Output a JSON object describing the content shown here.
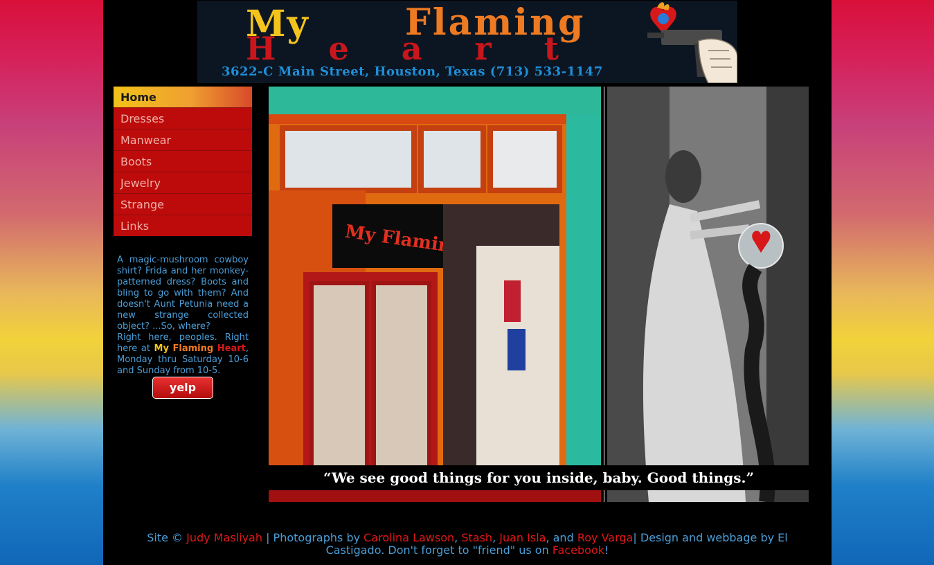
{
  "header": {
    "word_my": "My",
    "word_flaming": "Flaming",
    "word_heart": "Heart",
    "address": "3622-C Main Street, Houston, Texas (713) 533-1147",
    "logo_icon": "flaming-heart-pistol-icon"
  },
  "nav": {
    "items": [
      {
        "label": "Home",
        "active": true
      },
      {
        "label": "Dresses"
      },
      {
        "label": "Manwear"
      },
      {
        "label": "Boots"
      },
      {
        "label": "Jewelry"
      },
      {
        "label": "Strange"
      },
      {
        "label": "Links"
      }
    ]
  },
  "blurb": {
    "text1": "A magic-mushroom cowboy shirt? Frida and her monkey-patterned dress? Boots and bling to go with them? And doesn't Aunt Petunia need a new strange collected object? ...So, where?",
    "text2": "Right here, peoples. Right here at",
    "my": "My",
    "flaming": "Flaming",
    "heart": "Heart",
    "text3": ", Monday thru Saturday 10-6 and Sunday from 10-5.",
    "yelp_label": "yelp"
  },
  "photo": {
    "storefront_sign": "My Flaming Heart",
    "caption": "“We see good things for you inside, baby. Good things.”"
  },
  "footer": {
    "site": "Site ©",
    "owner": "Judy Masliyah",
    "photos_by": "| Photographs by",
    "photographer1": "Carolina Lawson",
    "sep1": ",",
    "photographer2": "Stash",
    "sep2": ",",
    "photographer3": "Juan Isla",
    "and": ", and",
    "photographer4": "Roy Varga",
    "design": "| Design and webbage by El Castigado. Don't forget to \"friend\" us on",
    "facebook": "Facebook",
    "end": "!"
  },
  "colors": {
    "nav_bg": "#bd0b0b",
    "text_blue": "#4a9ed8",
    "link_red": "#e01818",
    "yellow": "#f5c41c",
    "orange": "#ee7a22"
  }
}
